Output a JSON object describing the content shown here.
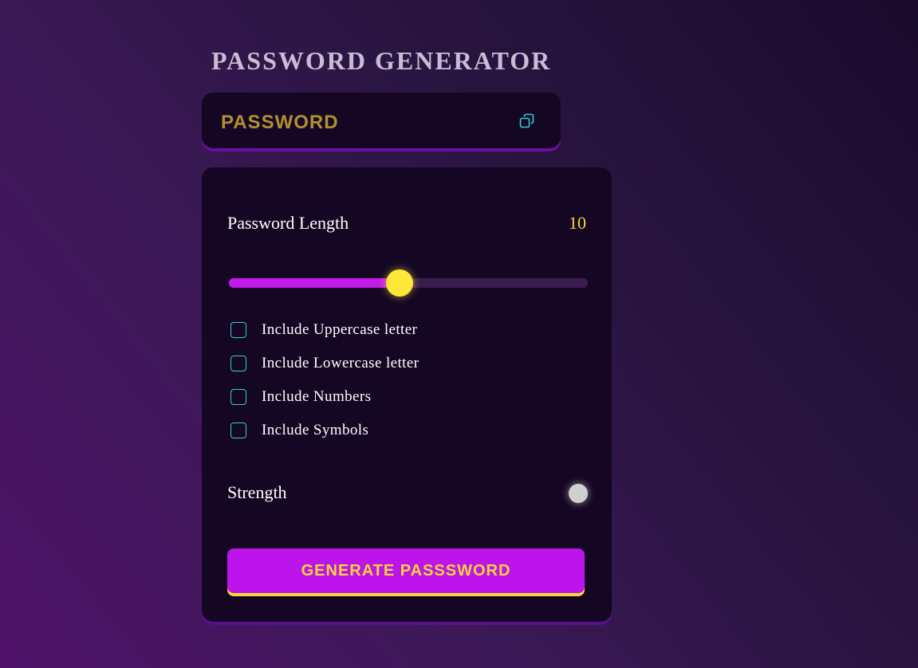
{
  "app": {
    "title": "PASSWORD GENERATOR"
  },
  "display": {
    "password_text": "PASSWORD",
    "copy_icon": "copy-icon"
  },
  "length": {
    "label": "Password Length",
    "value": "10",
    "slider_fraction": 0.475
  },
  "options": [
    {
      "label": "Include Uppercase letter",
      "checked": false
    },
    {
      "label": "Include Lowercase letter",
      "checked": false
    },
    {
      "label": "Include Numbers",
      "checked": false
    },
    {
      "label": "Include Symbols",
      "checked": false
    }
  ],
  "strength": {
    "label": "Strength",
    "indicator_color": "#cfcfcf"
  },
  "generate_button": {
    "label": "GENERATE PASSSWORD"
  },
  "colors": {
    "accent_purple": "#bd14ec",
    "accent_yellow": "#f7d637",
    "checkbox_border": "#2fd0d0",
    "card_background": "#150724"
  }
}
